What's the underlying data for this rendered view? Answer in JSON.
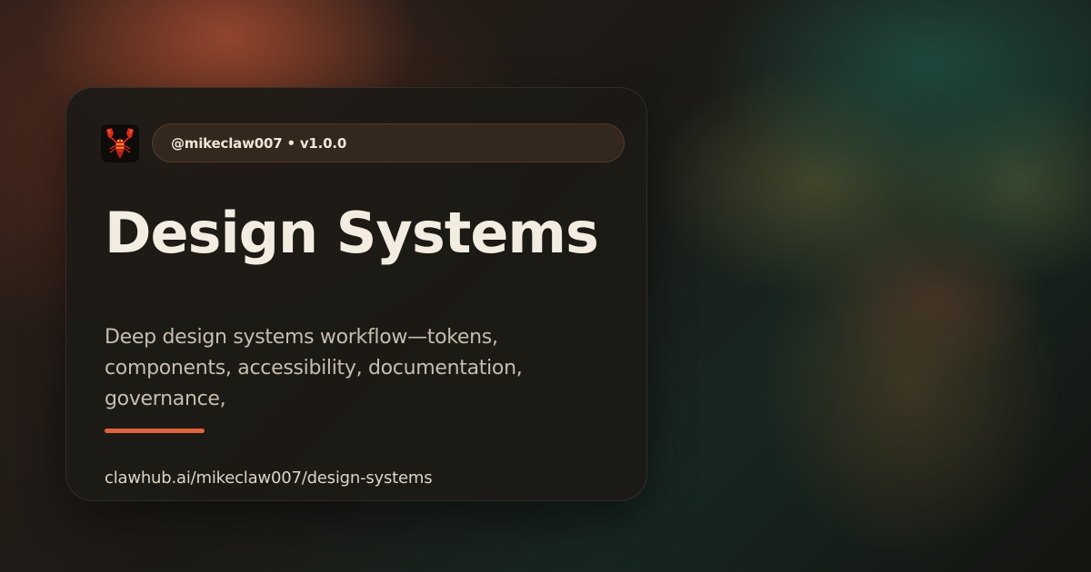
{
  "card": {
    "avatar_icon": "lobster-icon",
    "meta": {
      "handle": "@mikeclaw007",
      "separator": "•",
      "version": "v1.0.0"
    },
    "title": "Design Systems",
    "description": "Deep design systems workflow—tokens, components, accessibility, documentation, governance,",
    "url": "clawhub.ai/mikeclaw007/design-systems"
  },
  "colors": {
    "accent": "#e0623e",
    "title_text": "#f3ece0",
    "card_background": "#1c1a16"
  }
}
